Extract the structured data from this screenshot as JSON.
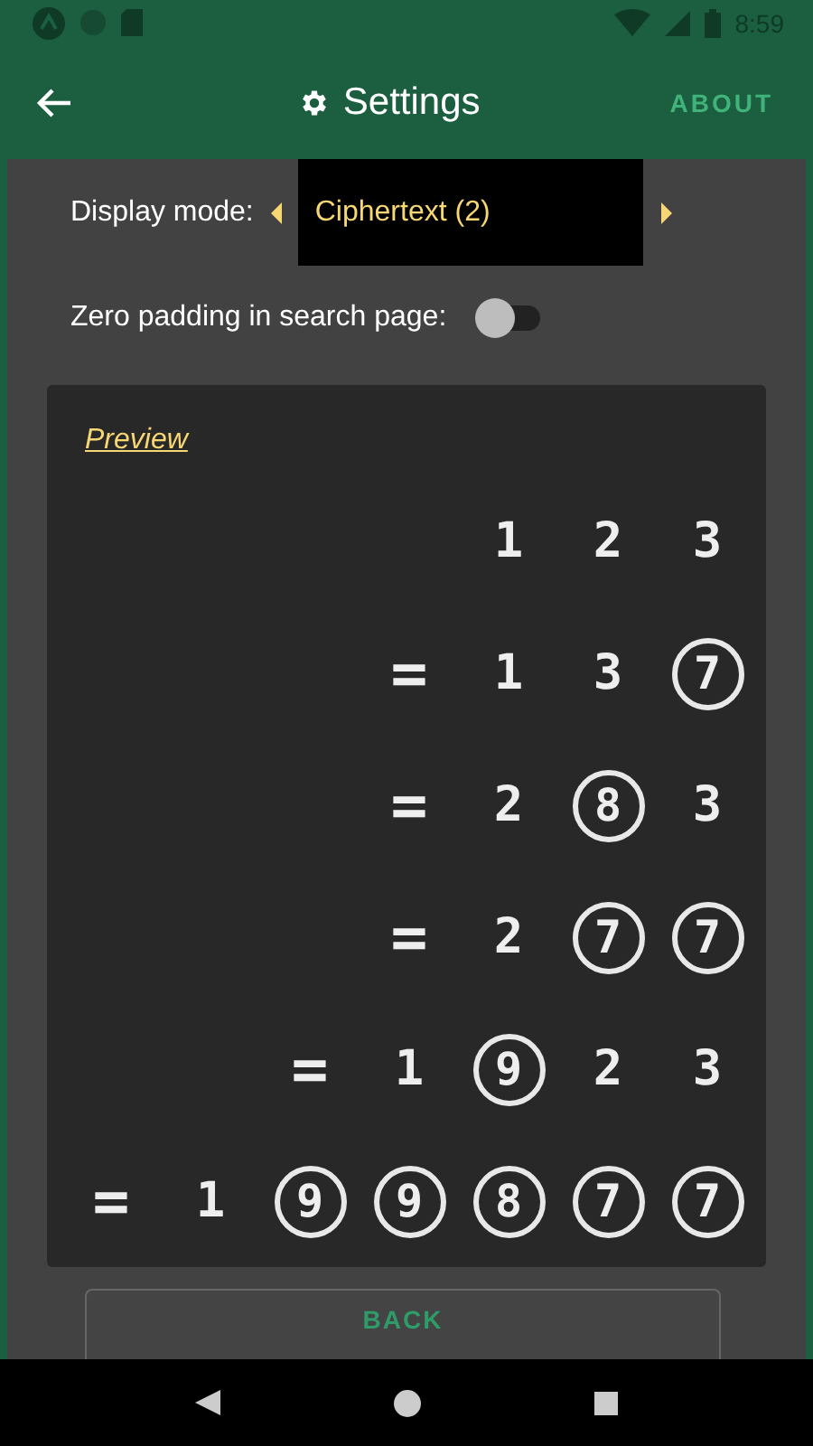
{
  "status_bar": {
    "time": "8:59"
  },
  "app_bar": {
    "title": "Settings",
    "action": "ABOUT"
  },
  "display_mode": {
    "label": "Display mode:",
    "value": "Ciphertext (2)"
  },
  "zero_padding": {
    "label": "Zero padding in search page:",
    "on": false
  },
  "preview": {
    "title": "Preview",
    "rows": [
      [
        {
          "kind": "blank"
        },
        {
          "kind": "blank"
        },
        {
          "kind": "blank"
        },
        {
          "kind": "blank"
        },
        {
          "kind": "digit",
          "text": "1"
        },
        {
          "kind": "digit",
          "text": "2"
        },
        {
          "kind": "digit",
          "text": "3"
        }
      ],
      [
        {
          "kind": "blank"
        },
        {
          "kind": "blank"
        },
        {
          "kind": "blank"
        },
        {
          "kind": "equals",
          "text": "="
        },
        {
          "kind": "digit",
          "text": "1"
        },
        {
          "kind": "digit",
          "text": "3"
        },
        {
          "kind": "circled",
          "text": "7"
        }
      ],
      [
        {
          "kind": "blank"
        },
        {
          "kind": "blank"
        },
        {
          "kind": "blank"
        },
        {
          "kind": "equals",
          "text": "="
        },
        {
          "kind": "digit",
          "text": "2"
        },
        {
          "kind": "circled",
          "text": "8"
        },
        {
          "kind": "digit",
          "text": "3"
        }
      ],
      [
        {
          "kind": "blank"
        },
        {
          "kind": "blank"
        },
        {
          "kind": "blank"
        },
        {
          "kind": "equals",
          "text": "="
        },
        {
          "kind": "digit",
          "text": "2"
        },
        {
          "kind": "circled",
          "text": "7"
        },
        {
          "kind": "circled",
          "text": "7"
        }
      ],
      [
        {
          "kind": "blank"
        },
        {
          "kind": "blank"
        },
        {
          "kind": "equals",
          "text": "="
        },
        {
          "kind": "digit",
          "text": "1"
        },
        {
          "kind": "circled",
          "text": "9"
        },
        {
          "kind": "digit",
          "text": "2"
        },
        {
          "kind": "digit",
          "text": "3"
        }
      ],
      [
        {
          "kind": "equals",
          "text": "="
        },
        {
          "kind": "digit",
          "text": "1"
        },
        {
          "kind": "circled",
          "text": "9"
        },
        {
          "kind": "circled",
          "text": "9"
        },
        {
          "kind": "circled",
          "text": "8"
        },
        {
          "kind": "circled",
          "text": "7"
        },
        {
          "kind": "circled",
          "text": "7"
        }
      ]
    ]
  },
  "back_button": "BACK"
}
